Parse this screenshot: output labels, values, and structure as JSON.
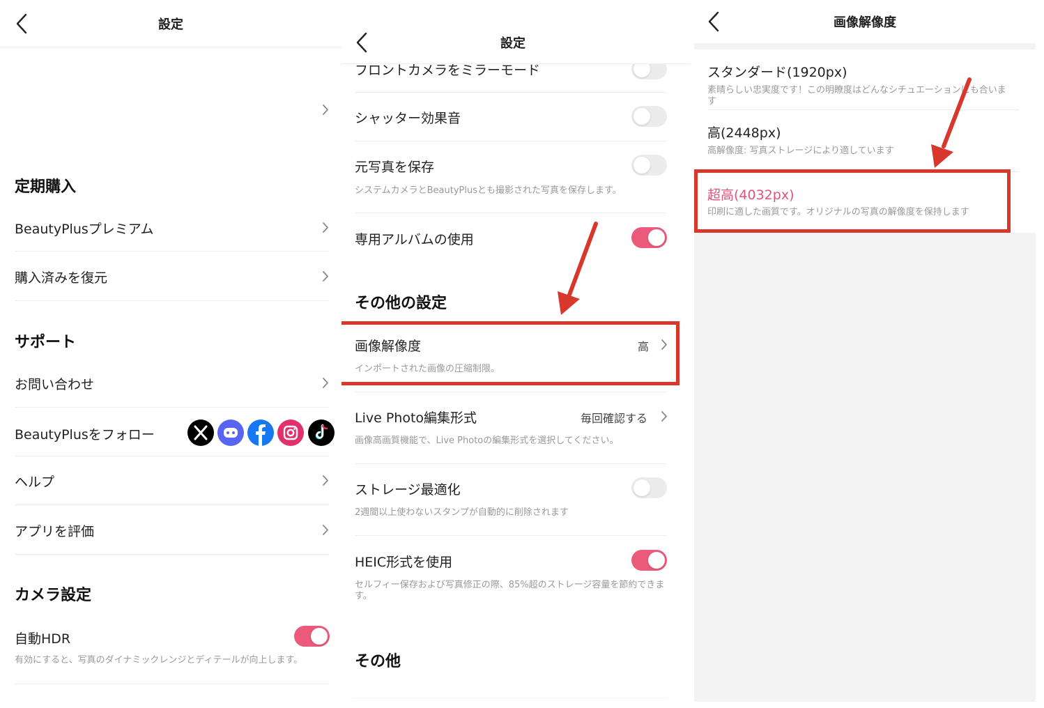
{
  "panel1": {
    "header_title": "設定",
    "section_subscription": "定期購入",
    "premium_label": "BeautyPlusプレミアム",
    "restore_label": "購入済みを復元",
    "section_support": "サポート",
    "contact_label": "お問い合わせ",
    "follow_label": "BeautyPlusをフォロー",
    "help_label": "ヘルプ",
    "rate_label": "アプリを評価",
    "section_camera": "カメラ設定",
    "hdr_label": "自動HDR",
    "hdr_desc": "有効にすると、写真のダイナミックレンジとディテールが向上します。",
    "hdr_on": true,
    "social_icons": [
      "x-icon",
      "discord-icon",
      "facebook-icon",
      "instagram-icon",
      "tiktok-icon"
    ]
  },
  "panel2": {
    "header_title": "設定",
    "mirror_label": "フロントカメラをミラーモード",
    "shutter_label": "シャッター効果音",
    "save_original_label": "元写真を保存",
    "save_original_desc": "システムカメラとBeautyPlusとも撮影された写真を保存します。",
    "album_label": "専用アルバムの使用",
    "section_other_settings": "その他の設定",
    "resolution_label": "画像解像度",
    "resolution_value": "高",
    "resolution_desc": "インポートされた画像の圧縮制限。",
    "live_label": "Live Photo編集形式",
    "live_value": "毎回確認する",
    "live_desc": "画像高画質機能で、Live Photoの編集形式を選択してください。",
    "storage_label": "ストレージ最適化",
    "storage_desc": "2週間以上使わないスタンプが自動的に削除されます",
    "heic_label": "HEIC形式を使用",
    "heic_desc": "セルフィー保存および写真修正の際、85%超のストレージ容量を節約できます。",
    "section_other": "その他",
    "toggles": {
      "mirror": false,
      "shutter": false,
      "save_original": false,
      "album": true,
      "storage": false,
      "heic": true
    }
  },
  "panel3": {
    "header_title": "画像解像度",
    "standard_label": "スタンダード(1920px)",
    "standard_desc": "素晴らしい忠実度です！この明瞭度はどんなシチュエーションにも合います",
    "high_label": "高(2448px)",
    "high_desc": "高解像度: 写真ストレージにより適しています",
    "ultra_label": "超高(4032px)",
    "ultra_desc": "印刷に適した画質です。オリジナルの写真の解像度を保持します"
  },
  "colors": {
    "accent_pink": "#ec5a7b",
    "annotation_red": "#d7382b",
    "selected_text": "#e0527a"
  }
}
